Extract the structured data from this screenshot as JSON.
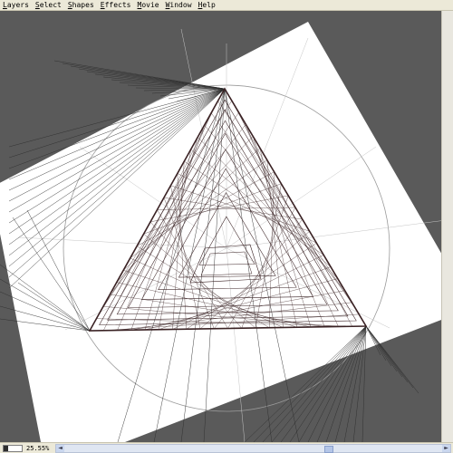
{
  "menubar": {
    "items": [
      {
        "mnemonic": "L",
        "rest": "ayers"
      },
      {
        "mnemonic": "S",
        "rest": "elect"
      },
      {
        "mnemonic": "S",
        "rest": "hapes"
      },
      {
        "mnemonic": "E",
        "rest": "ffects"
      },
      {
        "mnemonic": "M",
        "rest": "ovie"
      },
      {
        "mnemonic": "W",
        "rest": "indow"
      },
      {
        "mnemonic": "H",
        "rest": "elp"
      }
    ]
  },
  "status": {
    "zoom_label": "25.55%",
    "zoom_level": 0.26,
    "scroll_left_icon": "◄",
    "scroll_right_icon": "►",
    "hscroll_position": 0.69
  },
  "canvas": {
    "document": "rotated white page with triangular perspective line drawing",
    "colors": {
      "workspace": "#5a5a5a",
      "page": "#ffffff",
      "guide": "#9a9a9a",
      "triangle": "#3a2224",
      "rays": "#2e2e2e"
    }
  }
}
